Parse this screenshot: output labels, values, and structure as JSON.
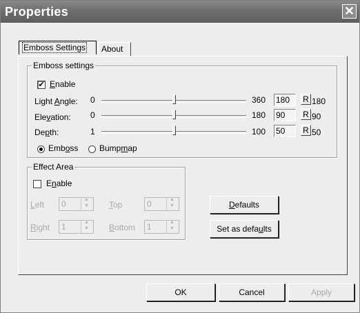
{
  "window": {
    "title": "Properties"
  },
  "tabs": [
    {
      "label": "Emboss Settings"
    },
    {
      "label": "About"
    }
  ],
  "emboss": {
    "group_title": "Emboss settings",
    "enable_label": "Enable",
    "enable_checked": true,
    "rows": [
      {
        "label": "Light Angle:",
        "min": "0",
        "max": "360",
        "value": "180",
        "reset": "R",
        "readout": "180",
        "fraction": 0.5
      },
      {
        "label": "Elevation:",
        "min": "0",
        "max": "180",
        "value": "90",
        "reset": "R",
        "readout": "90",
        "fraction": 0.5
      },
      {
        "label": "Depth:",
        "min": "1",
        "max": "100",
        "value": "50",
        "reset": "R",
        "readout": "50",
        "fraction": 0.5
      }
    ],
    "mode_emboss": "Emboss",
    "mode_bumpmap": "Bumpmap",
    "selected_mode": "Emboss"
  },
  "effect": {
    "group_title": "Effect Area",
    "enable_label": "Enable",
    "enable_checked": false,
    "left_label": "Left",
    "left_value": "0",
    "top_label": "Top",
    "top_value": "0",
    "right_label": "Right",
    "right_value": "1",
    "bottom_label": "Bottom",
    "bottom_value": "1"
  },
  "buttons": {
    "defaults": "Defaults",
    "set_defaults": "Set as defaults",
    "ok": "OK",
    "cancel": "Cancel",
    "apply": "Apply"
  },
  "icons": {
    "close": "close-icon",
    "check": "check-icon"
  }
}
